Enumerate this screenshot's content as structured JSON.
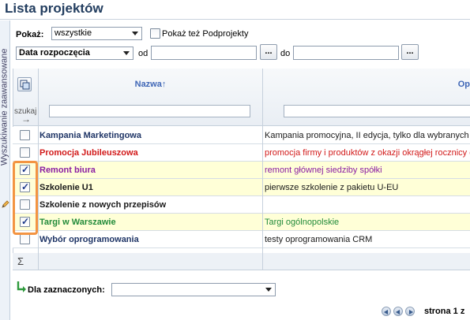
{
  "page": {
    "title": "Lista projektów"
  },
  "sidebar": {
    "tab_label": "Wyszukiwanie zaawansowane"
  },
  "filters": {
    "show_label": "Pokaż:",
    "show_value": "wszystkie",
    "subprojects_label": "Pokaż też Podprojekty",
    "subprojects_checked": false,
    "date_field_value": "Data rozpoczęcia",
    "from_label": "od",
    "to_label": "do",
    "dots_label": "..."
  },
  "table": {
    "search_label": "szukaj",
    "columns": [
      {
        "label": "Nazwa↑"
      },
      {
        "label": "Op"
      }
    ],
    "rows": [
      {
        "name": "Kampania Marketingowa",
        "description": "Kampania promocyjna, II edycja, tylko dla wybranych",
        "checked": false,
        "color": "#1f3566",
        "selected": false
      },
      {
        "name": "Promocja Jubileuszowa",
        "description": "promocja firmy i produktów z okazji okrągłej rocznicy dz",
        "checked": false,
        "color": "#d21a1a",
        "selected": false
      },
      {
        "name": "Remont biura",
        "description": "remont głównej siedziby spółki",
        "checked": true,
        "color": "#8b1fa3",
        "selected": true
      },
      {
        "name": "Szkolenie U1",
        "description": "pierwsze szkolenie z pakietu U-EU",
        "checked": true,
        "color": "#1a1a1a",
        "selected": true
      },
      {
        "name": "Szkolenie z nowych przepisów",
        "description": "",
        "checked": false,
        "color": "#1a1a1a",
        "selected": false
      },
      {
        "name": "Targi w Warszawie",
        "description": "Targi ogólnopolskie",
        "checked": true,
        "color": "#228b3a",
        "selected": true
      },
      {
        "name": "Wybór oprogramowania",
        "description": "testy oprogramowania CRM",
        "checked": false,
        "color": "#1f3566",
        "selected": false
      }
    ],
    "sum_symbol": "Σ"
  },
  "footer": {
    "for_selected_label": "Dla zaznaczonych:",
    "for_selected_value": "",
    "page_text": "strona 1 z"
  }
}
